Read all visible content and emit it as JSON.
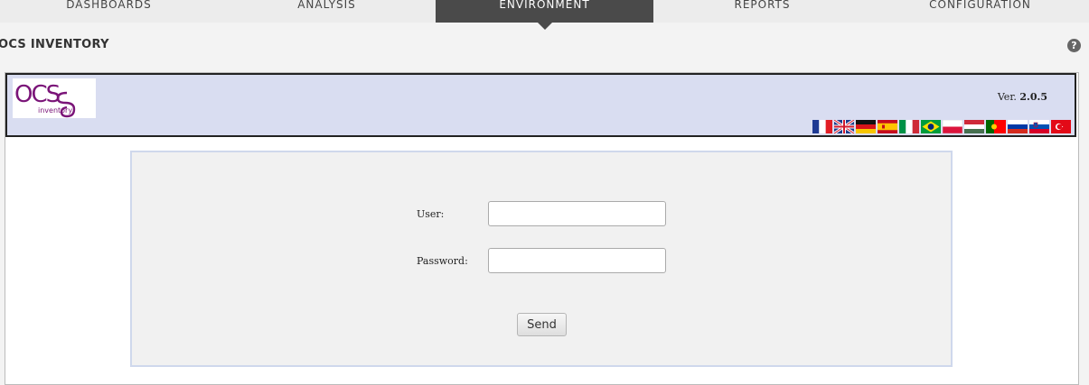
{
  "nav": {
    "tabs": [
      {
        "label": "DASHBOARDS",
        "active": false
      },
      {
        "label": "ANALYSIS",
        "active": false
      },
      {
        "label": "ENVIRONMENT",
        "active": true
      },
      {
        "label": "REPORTS",
        "active": false
      },
      {
        "label": "CONFIGURATION",
        "active": false
      }
    ]
  },
  "page": {
    "title": "OCS INVENTORY",
    "help_icon": "question-circle-icon"
  },
  "app": {
    "logo_text": "OCS",
    "logo_sub": "inventory",
    "version_prefix": "Ver.",
    "version": "2.0.5",
    "languages": [
      "french-flag-icon",
      "english-flag-icon",
      "german-flag-icon",
      "spanish-flag-icon",
      "italian-flag-icon",
      "brazilian-flag-icon",
      "polish-flag-icon",
      "hungarian-flag-icon",
      "portuguese-flag-icon",
      "russian-flag-icon",
      "slovenian-flag-icon",
      "turkish-flag-icon"
    ]
  },
  "login": {
    "user_label": "User:",
    "user_value": "",
    "password_label": "Password:",
    "password_value": "",
    "send_label": "Send"
  },
  "colors": {
    "active_tab": "#4a4a4a",
    "header_band": "#d9ddf1",
    "logo_purple": "#7a1478"
  }
}
